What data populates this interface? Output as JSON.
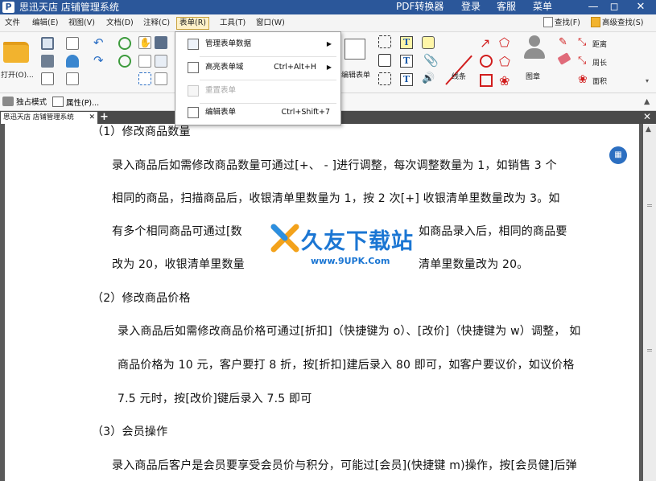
{
  "titlebar": {
    "title": "思迅天店 店铺管理系统",
    "pdf_converter": "PDF转换器",
    "login": "登录",
    "service": "客服",
    "menu": "菜单"
  },
  "menubar": {
    "items": [
      "文件",
      "编辑(E)",
      "视图(V)",
      "文档(D)",
      "注释(C)",
      "表单(R)",
      "工具(T)",
      "窗口(W)"
    ],
    "find": "查找(F)",
    "advanced_find": "高级查找(S)"
  },
  "ribbon": {
    "open_label": "打开(O)...",
    "edit_form_label": "编辑表单",
    "lines_label": "线条",
    "stamp_label": "图章",
    "distance_label": "距离",
    "perimeter_label": "周长",
    "area_label": "面积"
  },
  "strip2": {
    "exclusive_mode": "独占模式",
    "properties": "属性(P)..."
  },
  "tab": {
    "label": "思迅天店 店铺管理系统"
  },
  "dropdown": {
    "items": [
      {
        "label": "管理表单数据",
        "shortcut": "",
        "submenu": true,
        "disabled": false
      },
      {
        "label": "高亮表单域",
        "shortcut": "Ctrl+Alt+H",
        "submenu": true,
        "disabled": false
      },
      {
        "label": "重置表单",
        "shortcut": "",
        "submenu": false,
        "disabled": true
      },
      {
        "label": "编辑表单",
        "shortcut": "Ctrl+Shift+7",
        "submenu": false,
        "disabled": false
      }
    ]
  },
  "document": {
    "lines": [
      "（1）修改商品数量",
      "录入商品后如需修改商品数量可通过[+、 - ]进行调整，每次调整数量为 1，如销售 3 个",
      "相同的商品，扫描商品后，收银清单里数量为 1，按 2 次[+] 收银清单里数量改为 3。如",
      "有多个相同商品可通过[数",
      "如商品录入后，相同的商品要",
      "改为 20，收银清单里数量",
      "清单里数量改为 20。",
      "（2）修改商品价格",
      "录入商品后如需修改商品价格可通过[折扣]（快捷键为 o）、[改价]（快捷键为 w）调整， 如",
      "商品价格为 10 元，客户要打 8 折，按[折扣]建后录入 80 即可，如客户要议价，如议价格",
      "7.5 元时，按[改价]键后录入 7.5 即可",
      "（3）会员操作",
      "录入商品后客户是会员要享受会员价与积分，可能过[会员](快捷键 m)操作，按[会员健]后弹"
    ],
    "watermark_brand": "久友下载站",
    "watermark_url": "www.9UPK.Com"
  },
  "colors": {
    "titlebar": "#2b579a",
    "accent_blue": "#1b76d3",
    "red_tool": "#d11d1d"
  }
}
